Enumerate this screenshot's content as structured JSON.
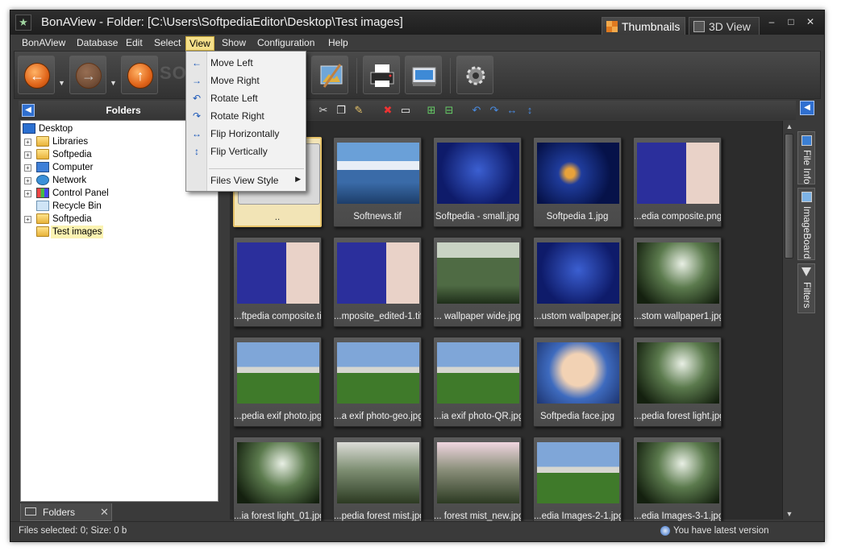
{
  "window": {
    "title": "BonAView - Folder: [C:\\Users\\SoftpediaEditor\\Desktop\\Test images]",
    "logo": "★",
    "controls": [
      "–",
      "□",
      "✕"
    ]
  },
  "view_tabs": [
    {
      "label": "Thumbnails",
      "icon": "thumbnails-icon"
    },
    {
      "label": "3D View",
      "icon": "3d-view-icon"
    }
  ],
  "menubar": [
    "BonAView",
    "Database",
    "Edit",
    "Select",
    "View",
    "Show",
    "Configuration",
    "Help"
  ],
  "view_menu": {
    "items": [
      {
        "label": "Move Left",
        "icon": "←"
      },
      {
        "label": "Move Right",
        "icon": "→"
      },
      {
        "label": "Rotate Left",
        "icon": "↶"
      },
      {
        "label": "Rotate Right",
        "icon": "↷"
      },
      {
        "label": "Flip Horizontally",
        "icon": "↔"
      },
      {
        "label": "Flip Vertically",
        "icon": "↕"
      },
      {
        "label": "Files View Style",
        "icon": ""
      }
    ],
    "submenu_arrow": "▶"
  },
  "toolbar": {
    "back_arrow": "←",
    "forward_arrow": "→",
    "up_arrow": "↑",
    "dropdown": "▼",
    "watermark": "SOFTPEDIA"
  },
  "folders_panel": {
    "title": "Folders",
    "tab_label": "Folders",
    "tab_close": "✕",
    "tree": [
      {
        "label": "Desktop",
        "icon": "desktop-icon",
        "expander": ""
      },
      {
        "label": "Libraries",
        "icon": "folder-icon",
        "expander": "+"
      },
      {
        "label": "Softpedia",
        "icon": "folder-icon",
        "expander": "+"
      },
      {
        "label": "Computer",
        "icon": "computer-icon",
        "expander": "+"
      },
      {
        "label": "Network",
        "icon": "network-icon",
        "expander": "+"
      },
      {
        "label": "Control Panel",
        "icon": "control-panel-icon",
        "expander": "+"
      },
      {
        "label": "Recycle Bin",
        "icon": "recycle-bin-icon",
        "expander": ""
      },
      {
        "label": "Softpedia",
        "icon": "folder-icon",
        "expander": "+"
      },
      {
        "label": "Test images",
        "icon": "folder-icon",
        "expander": "",
        "selected": true
      }
    ]
  },
  "thumbnails": [
    {
      "name": "..",
      "style": "img-parent",
      "selected": true
    },
    {
      "name": "Softnews.tif",
      "style": "img-sea"
    },
    {
      "name": "Softpedia  - small.jpg",
      "style": "img-blue"
    },
    {
      "name": "Softpedia 1.jpg",
      "style": "img-swirl"
    },
    {
      "name": "...edia composite.png",
      "style": "img-composite"
    },
    {
      "name": "...ftpedia composite.tif",
      "style": "img-composite"
    },
    {
      "name": "...mposite_edited-1.tif",
      "style": "img-composite"
    },
    {
      "name": "... wallpaper wide.jpg",
      "style": "img-forest"
    },
    {
      "name": "...ustom wallpaper.jpg",
      "style": "img-blue"
    },
    {
      "name": "...stom wallpaper1.jpg",
      "style": "img-forest-dark"
    },
    {
      "name": "...pedia exif photo.jpg",
      "style": "img-mountain"
    },
    {
      "name": "...a exif photo-geo.jpg",
      "style": "img-mountain"
    },
    {
      "name": "...ia exif photo-QR.jpg",
      "style": "img-mountain"
    },
    {
      "name": "Softpedia face.jpg",
      "style": "img-face"
    },
    {
      "name": "...pedia forest light.jpg",
      "style": "img-forest-dark"
    },
    {
      "name": "...ia forest light_01.jpg",
      "style": "img-forest-dark"
    },
    {
      "name": "...pedia forest mist.jpg",
      "style": "img-mist"
    },
    {
      "name": "... forest mist_new.jpg",
      "style": "img-mist-pink"
    },
    {
      "name": "...edia Images-2-1.jpg",
      "style": "img-mountain"
    },
    {
      "name": "...edia Images-3-1.jpg",
      "style": "img-forest-dark"
    }
  ],
  "side_tabs": [
    {
      "label": "File Info",
      "icon": "file-info-icon"
    },
    {
      "label": "ImageBoard",
      "icon": "imageboard-icon"
    },
    {
      "label": "Filters",
      "icon": "filters-icon"
    }
  ],
  "status": {
    "left": "Files selected: 0; Size: 0 b",
    "right": "You have latest version"
  },
  "colors": {
    "accent": "#f5e08a",
    "menu_bg": "#f2f2f2",
    "window_bg": "#3a3a3a"
  }
}
